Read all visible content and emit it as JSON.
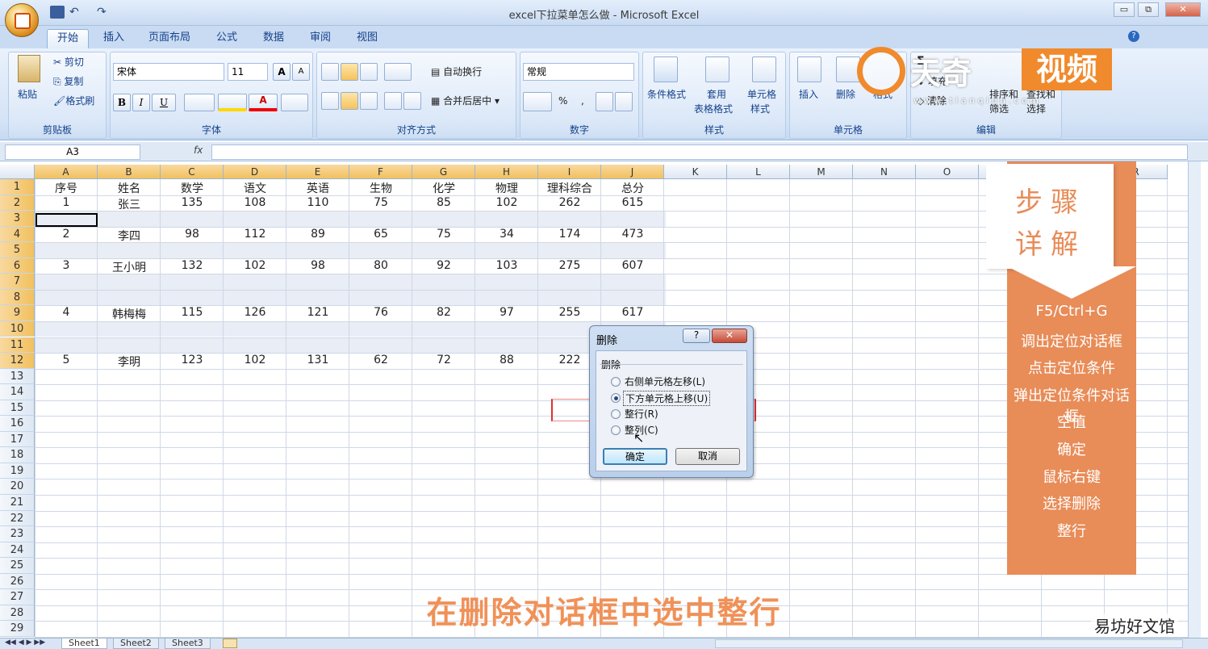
{
  "window": {
    "title": "excel下拉菜单怎么做 - Microsoft Excel",
    "min": "▭",
    "max": "⧉",
    "close": "✕"
  },
  "tabs": [
    "开始",
    "插入",
    "页面布局",
    "公式",
    "数据",
    "审阅",
    "视图"
  ],
  "ribbon": {
    "clipboard": {
      "paste": "粘贴",
      "cut": "剪切",
      "copy": "复制",
      "format_painter": "格式刷",
      "label": "剪贴板"
    },
    "font": {
      "name": "宋体",
      "size": "11",
      "grow": "A",
      "shrink": "A",
      "bold": "B",
      "italic": "I",
      "underline": "U",
      "label": "字体"
    },
    "align": {
      "wrap": "自动换行",
      "merge": "合并后居中",
      "label": "对齐方式"
    },
    "number": {
      "format": "常规",
      "percent": "%",
      "comma": ",",
      "label": "数字"
    },
    "styles": {
      "cond": "条件格式",
      "table": "套用",
      "table2": "表格格式",
      "cell_style": "单元格",
      "cell_style2": "样式",
      "label": "样式"
    },
    "cells": {
      "insert": "插入",
      "delete": "删除",
      "format": "格式",
      "label": "单元格"
    },
    "editing": {
      "sigma": "Σ",
      "fill": "填充",
      "clear": "清除",
      "sort": "排序和",
      "sort2": "筛选",
      "find": "查找和",
      "find2": "选择",
      "label": "编辑"
    }
  },
  "formula": {
    "namebox": "A3",
    "fx": "fx",
    "content": ""
  },
  "columns": [
    "A",
    "B",
    "C",
    "D",
    "E",
    "F",
    "G",
    "H",
    "I",
    "J",
    "K",
    "L",
    "M",
    "N",
    "O",
    "P",
    "Q",
    "R"
  ],
  "rows": [
    "1",
    "2",
    "3",
    "4",
    "5",
    "6",
    "7",
    "8",
    "9",
    "10",
    "11",
    "12",
    "13",
    "14",
    "15",
    "16",
    "17",
    "18",
    "19",
    "20",
    "21",
    "22",
    "23",
    "24",
    "25",
    "26",
    "27",
    "28",
    "29"
  ],
  "headers": [
    "序号",
    "姓名",
    "数学",
    "语文",
    "英语",
    "生物",
    "化学",
    "物理",
    "理科综合",
    "总分"
  ],
  "data": [
    {
      "row": 2,
      "values": [
        "1",
        "张三",
        "135",
        "108",
        "110",
        "75",
        "85",
        "102",
        "262",
        "615"
      ]
    },
    {
      "row": 4,
      "values": [
        "2",
        "李四",
        "98",
        "112",
        "89",
        "65",
        "75",
        "34",
        "174",
        "473"
      ]
    },
    {
      "row": 6,
      "values": [
        "3",
        "王小明",
        "132",
        "102",
        "98",
        "80",
        "92",
        "103",
        "275",
        "607"
      ]
    },
    {
      "row": 9,
      "values": [
        "4",
        "韩梅梅",
        "115",
        "126",
        "121",
        "76",
        "82",
        "97",
        "255",
        "617"
      ]
    },
    {
      "row": 12,
      "values": [
        "5",
        "李明",
        "123",
        "102",
        "131",
        "62",
        "72",
        "88",
        "222",
        ""
      ]
    }
  ],
  "dialog": {
    "title": "删除",
    "help": "?",
    "close": "✕",
    "group": "删除",
    "options": [
      "右侧单元格左移(L)",
      "下方单元格上移(U)",
      "整行(R)",
      "整列(C)"
    ],
    "selected": 1,
    "ok": "确定",
    "cancel": "取消"
  },
  "overlay": {
    "logo_text": "天奇",
    "logo_video": "视频",
    "logo_url": "w w w . t i a n q i u n . c o m",
    "panel_title": [
      "步骤",
      "详解"
    ],
    "steps": [
      "F5/Ctrl+G",
      "调出定位对话框",
      "点击定位条件",
      "弹出定位条件对话框",
      "空值",
      "确定",
      "鼠标右键",
      "选择删除",
      "整行"
    ],
    "caption": "在删除对话框中选中整行",
    "watermark": "易坊好文馆"
  },
  "sheets": [
    "Sheet1",
    "Sheet2",
    "Sheet3"
  ],
  "colors": {
    "accent": "#e88c58",
    "ribbon": "#d4e3f6",
    "selected_header": "#f1c15f",
    "band": "#e8edf6"
  }
}
